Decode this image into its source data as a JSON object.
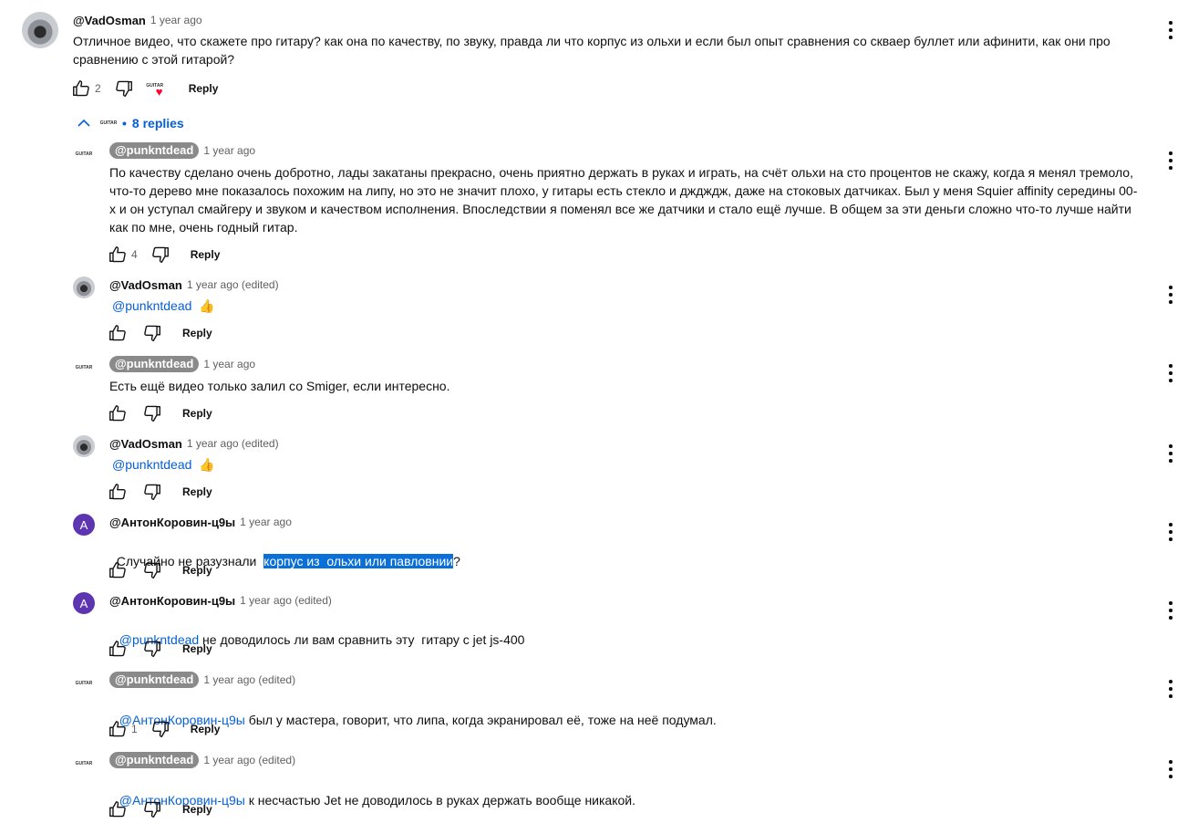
{
  "top_comment": {
    "author": "@VadOsman",
    "time": "1 year ago",
    "text_line1": "Отличное видео, что скажете про гитару? как она по качеству, по звуку, правда ли что корпус из ольхи и если был опыт сравнения со скваер буллет или афинити, как они про",
    "text_line2": "сравнению с этой гитарой?",
    "likes": "2",
    "reply_label": "Reply",
    "avatar_icon": "user-photo",
    "creator_heart_icon": "heart-icon",
    "creator_logo_text": "GUITAR"
  },
  "replies_toggle": {
    "label": "8 replies",
    "bullet": "•",
    "chevron_icon": "chevron-up-icon",
    "logo_text": "GUITAR"
  },
  "replies": [
    {
      "author": "@punkntdead",
      "creator": true,
      "time": "1 year ago",
      "lines": [
        "По качеству сделано очень добротно, лады закатаны прекрасно, очень приятно держать в руках и играть, на счёт ольхи на сто процентов не скажу, когда я менял тремоло,",
        "что-то дерево мне показалось похожим на липу, но это не значит плохо, у гитары есть стекло и дждждж, даже на стоковых датчиках. Был у меня Squier affinity середины 00-",
        "х и он уступал смайгеру и звуком и качеством исполнения. Впоследствии я поменял все же датчики и стало ещё лучше. В общем за эти деньги сложно что-то лучше найти",
        "как по мне, очень годный гитар."
      ],
      "likes": "4",
      "reply_label": "Reply",
      "avatar_text": "GUITAR"
    },
    {
      "author": "@VadOsman",
      "creator": false,
      "time": "1 year ago (edited)",
      "mention": "@punkntdead",
      "rest": "",
      "emoji": "👍",
      "likes": "",
      "reply_label": "Reply"
    },
    {
      "author": "@punkntdead",
      "creator": true,
      "time": "1 year ago",
      "text": "Есть ещё видео только залил со Smiger, если интересно.",
      "likes": "",
      "reply_label": "Reply",
      "avatar_text": "GUITAR"
    },
    {
      "author": "@VadOsman",
      "creator": false,
      "time": "1 year ago (edited)",
      "mention": "@punkntdead",
      "rest": "",
      "emoji": "👍",
      "likes": "",
      "reply_label": "Reply"
    },
    {
      "author": "@АнтонКоровин-ц9ы",
      "creator": false,
      "time": "1 year ago",
      "text_before": "Случайно не разузнали  ",
      "text_highlight": "корпус из  ольхи или павловнии",
      "text_after": "?",
      "likes": "",
      "reply_label": "Reply",
      "avatar_letter": "A"
    },
    {
      "author": "@АнтонКоровин-ц9ы",
      "creator": false,
      "time": "1 year ago (edited)",
      "mention": "@punkntdead",
      "rest": " не доводилось ли вам сравнить эту  гитару с jet js-400",
      "likes": "",
      "reply_label": "Reply",
      "avatar_letter": "A"
    },
    {
      "author": "@punkntdead",
      "creator": true,
      "time": "1 year ago (edited)",
      "mention": "@АнтонКоровин-ц9ы",
      "rest": " был у мастера, говорит, что липа, когда экранировал её, тоже на неё подумал.",
      "likes": "1",
      "reply_label": "Reply",
      "avatar_text": "GUITAR"
    },
    {
      "author": "@punkntdead",
      "creator": true,
      "time": "1 year ago (edited)",
      "mention": "@АнтонКоровин-ц9ы",
      "rest": " к несчастью Jet не доводилось в руках держать вообще никакой.",
      "likes": "",
      "reply_label": "Reply",
      "avatar_text": "GUITAR"
    }
  ],
  "colors": {
    "link": "#065fd4",
    "creator_chip": "#8a8a8a",
    "highlight": "#0a6fd6",
    "avatar_letter_bg": "#5e35b1",
    "heart": "#ff0033"
  },
  "icons": {
    "like": "thumbs-up-icon",
    "dislike": "thumbs-down-icon",
    "menu": "more-vert-icon"
  }
}
